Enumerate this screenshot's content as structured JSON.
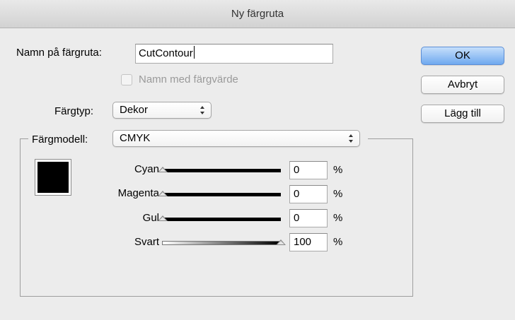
{
  "dialog": {
    "title": "Ny färgruta",
    "swatch_name_label": "Namn på färgruta:",
    "swatch_name_value": "CutContour",
    "name_with_value_label": "Namn med färgvärde",
    "color_type_label": "Färgtyp:",
    "color_type_value": "Dekor",
    "color_model_label": "Färgmodell:",
    "color_model_value": "CMYK",
    "swatch_color": "#000000"
  },
  "buttons": {
    "ok": "OK",
    "cancel": "Avbryt",
    "add": "Lägg till"
  },
  "sliders": [
    {
      "label": "Cyan",
      "value": "0",
      "unit": "%"
    },
    {
      "label": "Magenta",
      "value": "0",
      "unit": "%"
    },
    {
      "label": "Gul",
      "value": "0",
      "unit": "%"
    },
    {
      "label": "Svart",
      "value": "100",
      "unit": "%"
    }
  ],
  "icons": {
    "select_arrows": "updown-arrows-icon",
    "slider_thumb": "triangle-thumb-icon"
  }
}
